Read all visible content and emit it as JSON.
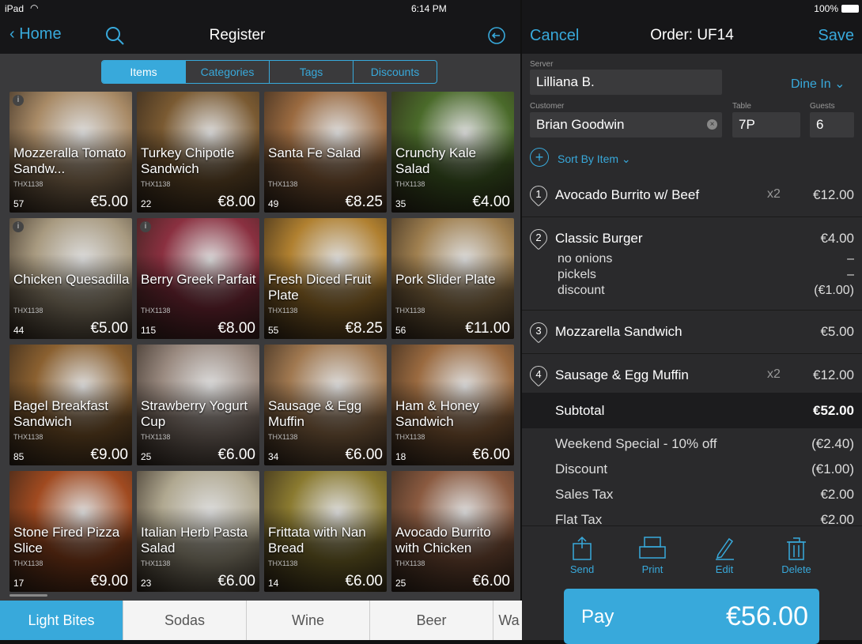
{
  "status": {
    "device": "iPad",
    "time": "6:14 PM",
    "battery": "100%"
  },
  "register": {
    "back_label": "Home",
    "title": "Register"
  },
  "segments": [
    "Items",
    "Categories",
    "Tags",
    "Discounts"
  ],
  "items": [
    {
      "name": "Mozzeralla Tomato Sandw...",
      "sku": "THX1138",
      "count": "57",
      "price": "€5.00",
      "info": true,
      "color": "#a88a66"
    },
    {
      "name": "Turkey Chipotle Sandwich",
      "sku": "THX1138",
      "count": "22",
      "price": "€8.00",
      "info": false,
      "color": "#7a5a32"
    },
    {
      "name": "Santa Fe Salad",
      "sku": "THX1138",
      "count": "49",
      "price": "€8.25",
      "info": false,
      "color": "#9a6a40"
    },
    {
      "name": "Crunchy Kale Salad",
      "sku": "THX1138",
      "count": "35",
      "price": "€4.00",
      "info": false,
      "color": "#4a6a2a"
    },
    {
      "name": "Chicken Quesadilla",
      "sku": "THX1138",
      "count": "44",
      "price": "€5.00",
      "info": true,
      "color": "#a89a80"
    },
    {
      "name": "Berry Greek Parfait",
      "sku": "THX1138",
      "count": "115",
      "price": "€8.00",
      "info": true,
      "color": "#8a3040"
    },
    {
      "name": "Fresh Diced Fruit Plate",
      "sku": "THX1138",
      "count": "55",
      "price": "€8.25",
      "info": false,
      "color": "#b08030"
    },
    {
      "name": "Pork Slider Plate",
      "sku": "THX1138",
      "count": "56",
      "price": "€11.00",
      "info": false,
      "color": "#a08050"
    },
    {
      "name": "Bagel Breakfast Sandwich",
      "sku": "THX1138",
      "count": "85",
      "price": "€9.00",
      "info": false,
      "color": "#8a6030"
    },
    {
      "name": "Strawberry Yogurt Cup",
      "sku": "THX1138",
      "count": "25",
      "price": "€6.00",
      "info": false,
      "color": "#9a8a80"
    },
    {
      "name": "Sausage & Egg Muffin",
      "sku": "THX1138",
      "count": "34",
      "price": "€6.00",
      "info": false,
      "color": "#a07850"
    },
    {
      "name": "Ham & Honey Sandwich",
      "sku": "THX1138",
      "count": "18",
      "price": "€6.00",
      "info": false,
      "color": "#9a6a40"
    },
    {
      "name": "Stone Fired Pizza Slice",
      "sku": "THX1138",
      "count": "17",
      "price": "€9.00",
      "info": false,
      "color": "#a04a20"
    },
    {
      "name": "Italian Herb Pasta Salad",
      "sku": "THX1138",
      "count": "23",
      "price": "€6.00",
      "info": false,
      "color": "#b0a890"
    },
    {
      "name": "Frittata with Nan Bread",
      "sku": "THX1138",
      "count": "14",
      "price": "€6.00",
      "info": false,
      "color": "#8a7a30"
    },
    {
      "name": "Avocado Burrito with Chicken",
      "sku": "THX1138",
      "count": "25",
      "price": "€6.00",
      "info": false,
      "color": "#8a5a40"
    }
  ],
  "bottom_tabs": [
    "Light Bites",
    "Sodas",
    "Wine",
    "Beer",
    "Wa"
  ],
  "order": {
    "cancel_label": "Cancel",
    "title": "Order: UF14",
    "save_label": "Save",
    "server_label": "Server",
    "server": "Lilliana B.",
    "dining": "Dine In",
    "customer_label": "Customer",
    "customer": "Brian Goodwin",
    "table_label": "Table",
    "table": "7P",
    "guests_label": "Guests",
    "guests": "6",
    "sort_label": "Sort By Item",
    "lines": [
      {
        "num": "1",
        "name": "Avocado Burrito w/ Beef",
        "qty": "x2",
        "amount": "€12.00",
        "mods": []
      },
      {
        "num": "2",
        "name": "Classic Burger",
        "qty": "",
        "amount": "€4.00",
        "mods": [
          {
            "name": "no onions",
            "amount": "–"
          },
          {
            "name": "pickels",
            "amount": "–"
          },
          {
            "name": "discount",
            "amount": "(€1.00)"
          }
        ]
      },
      {
        "num": "3",
        "name": "Mozzarella Sandwich",
        "qty": "",
        "amount": "€5.00",
        "mods": []
      },
      {
        "num": "4",
        "name": "Sausage & Egg Muffin",
        "qty": "x2",
        "amount": "€12.00",
        "mods": []
      }
    ],
    "subtotal_label": "Subtotal",
    "subtotal": "€52.00",
    "adjustments": [
      {
        "name": "Weekend Special - 10% off",
        "amount": "(€2.40)"
      },
      {
        "name": "Discount",
        "amount": "(€1.00)"
      },
      {
        "name": "Sales Tax",
        "amount": "€2.00"
      },
      {
        "name": "Flat Tax",
        "amount": "€2.00"
      }
    ],
    "actions": [
      "Send",
      "Print",
      "Edit",
      "Delete"
    ],
    "pay_label": "Pay",
    "pay_amount": "€56.00"
  },
  "colors": {
    "accent": "#38a9db"
  }
}
